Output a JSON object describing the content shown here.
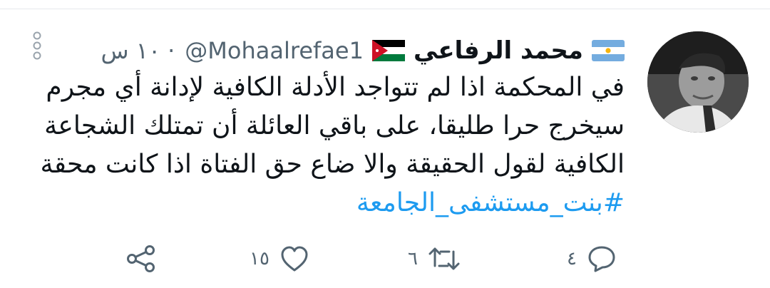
{
  "tweet": {
    "author_name": "محمد الرفاعي",
    "handle": "@Mohaalrefae1",
    "separator": "·",
    "time": "١٠ س",
    "lines": [
      "في المحكمة اذا لم تتواجد الأدلة الكافية لإدانة أي مجرم",
      "سيخرج حرا طليقا، على باقي العائلة أن تمتلك الشجاعة",
      "الكافية لقول الحقيقة والا ضاع حق الفتاة اذا كانت محقة"
    ],
    "hashtag": "#بنت_مستشفى_الجامعة",
    "hashtag_color": "#1d9bf0",
    "flags": [
      "argentina-flag-icon",
      "jordan-flag-icon"
    ]
  },
  "actions": {
    "reply_count": "٤",
    "retweet_count": "٦",
    "like_count": "١٥"
  }
}
